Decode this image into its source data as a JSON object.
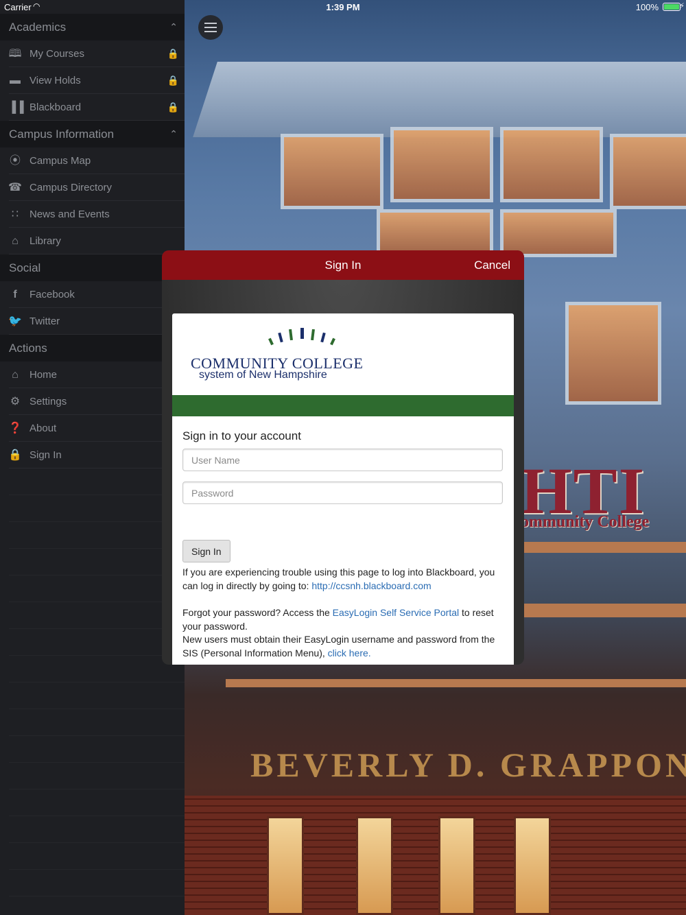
{
  "status_bar": {
    "carrier": "Carrier",
    "time": "1:39 PM",
    "battery": "100%"
  },
  "sidebar": {
    "sections": [
      {
        "title": "Academics",
        "collapsible": true,
        "items": [
          {
            "label": "My Courses",
            "icon": "book-icon",
            "locked": true
          },
          {
            "label": "View Holds",
            "icon": "chat-bubble-icon",
            "locked": true
          },
          {
            "label": "Blackboard",
            "icon": "library-books-icon",
            "locked": true
          }
        ]
      },
      {
        "title": "Campus Information",
        "collapsible": true,
        "items": [
          {
            "label": "Campus Map",
            "icon": "compass-icon"
          },
          {
            "label": "Campus Directory",
            "icon": "phone-icon"
          },
          {
            "label": "News and Events",
            "icon": "rss-icon"
          },
          {
            "label": "Library",
            "icon": "bank-icon"
          }
        ]
      },
      {
        "title": "Social",
        "items": [
          {
            "label": "Facebook",
            "icon": "facebook-icon"
          },
          {
            "label": "Twitter",
            "icon": "twitter-icon"
          }
        ]
      },
      {
        "title": "Actions",
        "items": [
          {
            "label": "Home",
            "icon": "home-icon"
          },
          {
            "label": "Settings",
            "icon": "gear-icon"
          },
          {
            "label": "About",
            "icon": "question-circle-icon"
          },
          {
            "label": "Sign In",
            "icon": "lock-icon"
          }
        ]
      }
    ]
  },
  "background": {
    "sign_text": "HTI",
    "sign_subtext": "ommunity College",
    "building_name": "BEVERLY  D.  GRAPPON"
  },
  "modal": {
    "title": "Sign In",
    "cancel": "Cancel",
    "logo": {
      "line1": "COMMUNITY COLLEGE",
      "line2": "system of New Hampshire"
    },
    "heading": "Sign in to your account",
    "username_placeholder": "User Name",
    "password_placeholder": "Password",
    "signin_button": "Sign In",
    "help": {
      "trouble_text": "If you are experiencing trouble using this page to log into Blackboard, you can log in directly by going to: ",
      "trouble_link": "http://ccsnh.blackboard.com",
      "forgot_text": "Forgot your password? Access the ",
      "forgot_link": "EasyLogin Self Service Portal",
      "forgot_tail": " to reset your password.",
      "newusers_text": "New users must obtain their EasyLogin username and password from the SIS (Personal Information Menu), ",
      "newusers_link": "click here."
    }
  },
  "colors": {
    "modal_header": "#8c0f15",
    "logo_green": "#2e6b2f",
    "logo_blue": "#1b2f6b",
    "link": "#2a6cb3",
    "sidebar_bg": "#1e1f23"
  }
}
